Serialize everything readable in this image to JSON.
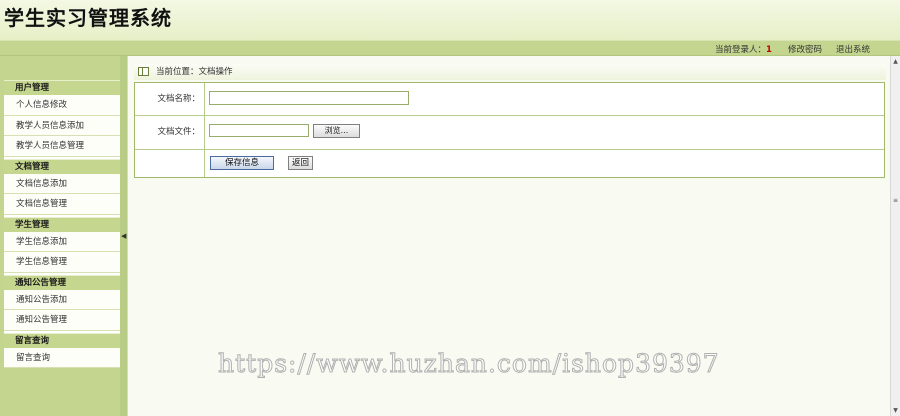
{
  "header": {
    "title": "学生实习管理系统"
  },
  "topbar": {
    "login_label": "当前登录人：",
    "login_value": "1",
    "links": [
      "修改密码",
      "退出系统"
    ]
  },
  "sidebar": {
    "groups": [
      {
        "title": "用户管理",
        "items": [
          "个人信息修改",
          "教学人员信息添加",
          "教学人员信息管理"
        ]
      },
      {
        "title": "文档管理",
        "items": [
          "文档信息添加",
          "文档信息管理"
        ]
      },
      {
        "title": "学生管理",
        "items": [
          "学生信息添加",
          "学生信息管理"
        ]
      },
      {
        "title": "通知公告管理",
        "items": [
          "通知公告添加",
          "通知公告管理"
        ]
      },
      {
        "title": "留言查询",
        "items": [
          "留言查询"
        ]
      }
    ]
  },
  "main": {
    "breadcrumb": "当前位置：文档操作",
    "form": {
      "name_label": "文档名称：",
      "name_value": "",
      "file_label": "文档文件：",
      "browse_label": "浏览...",
      "save_label": "保存信息",
      "back_label": "返回"
    }
  },
  "watermark": "https://www.huzhan.com/ishop39397",
  "colors": {
    "header_bg": "#e6efc7",
    "bar_green": "#c3d58f",
    "login_value": "#c00000",
    "border_green": "#9fb86a"
  },
  "icons": {
    "breadcrumb": "window-icon",
    "splitter": "collapse-arrow-icon",
    "scrollbar": [
      "scroll-up-icon",
      "scroll-down-icon"
    ]
  }
}
